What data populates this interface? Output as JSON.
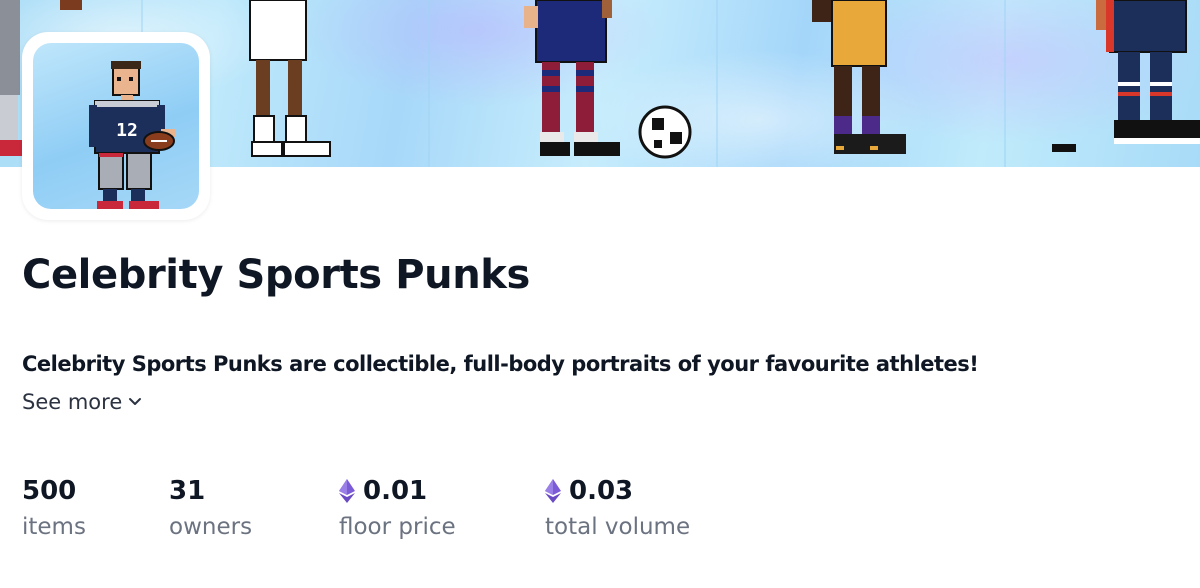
{
  "collection": {
    "name": "Celebrity Sports Punks",
    "description": "Celebrity Sports Punks are collectible, full-body portraits of your favourite athletes!",
    "see_more_label": "See more",
    "avatar_jersey_number": "12"
  },
  "stats": [
    {
      "value": "500",
      "label": "items",
      "eth": false
    },
    {
      "value": "31",
      "label": "owners",
      "eth": false
    },
    {
      "value": "0.01",
      "label": "floor price",
      "eth": true
    },
    {
      "value": "0.03",
      "label": "total volume",
      "eth": true
    }
  ],
  "colors": {
    "text_primary": "#0f1724",
    "text_secondary": "#6b7280",
    "eth_purple": "#7b5cd6",
    "banner_holo": "#b8e4fa"
  },
  "icons": {
    "eth": "ethereum-icon",
    "chevron": "chevron-down-icon"
  }
}
